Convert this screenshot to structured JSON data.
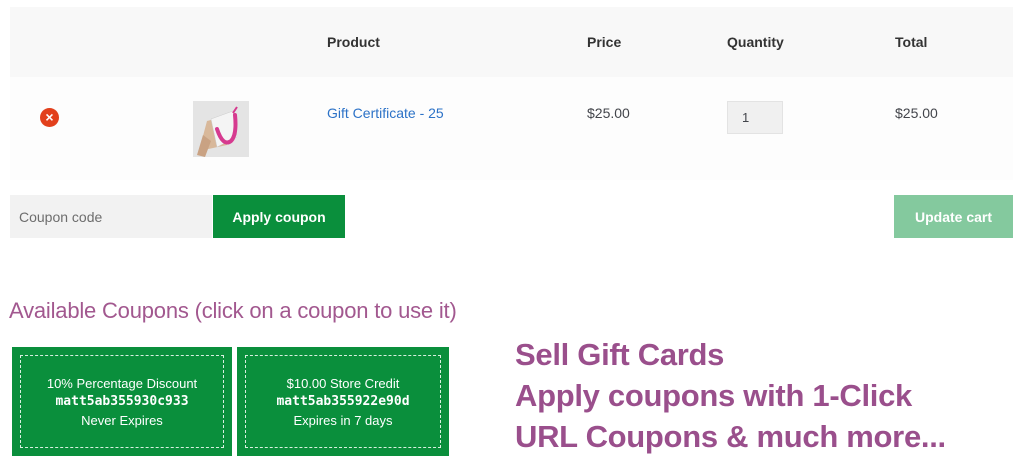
{
  "cart": {
    "headers": {
      "product": "Product",
      "price": "Price",
      "quantity": "Quantity",
      "total": "Total"
    },
    "item": {
      "remove_symbol": "×",
      "name": "Gift Certificate - 25",
      "price": "$25.00",
      "quantity": "1",
      "total": "$25.00"
    }
  },
  "actions": {
    "coupon_placeholder": "Coupon code",
    "apply_label": "Apply coupon",
    "update_label": "Update cart"
  },
  "available": {
    "heading": "Available Coupons (click on a coupon to use it)",
    "coupons": [
      {
        "title": "10% Percentage Discount",
        "code": "matt5ab355930c933",
        "expiry": "Never Expires"
      },
      {
        "title": "$10.00 Store Credit",
        "code": "matt5ab355922e90d",
        "expiry": "Expires in 7 days"
      }
    ]
  },
  "promo": {
    "line1": "Sell Gift Cards",
    "line2": "Apply coupons with 1-Click",
    "line3": "URL Coupons & much more..."
  },
  "colors": {
    "green": "#0a8f3c",
    "green_light": "#84c99e",
    "remove_red": "#e2401c",
    "link_blue": "#2c72c7",
    "purple": "#9a4f8c"
  }
}
